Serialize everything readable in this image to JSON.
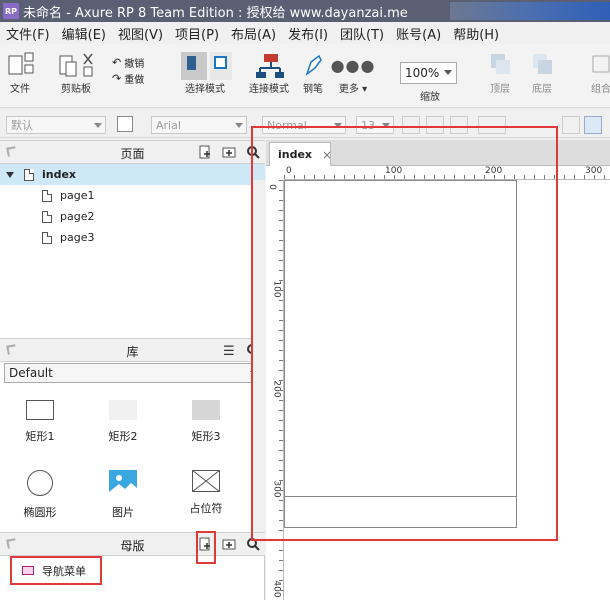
{
  "window": {
    "title": "未命名 - Axure RP 8 Team Edition : 授权给 www.dayanzai.me",
    "logo": "RP"
  },
  "menu": [
    "文件(F)",
    "编辑(E)",
    "视图(V)",
    "项目(P)",
    "布局(A)",
    "发布(I)",
    "团队(T)",
    "账号(A)",
    "帮助(H)"
  ],
  "toolbar": {
    "file": "文件",
    "clipboard": "剪贴板",
    "undo": "撤销",
    "redo": "重做",
    "select_mode": "选择模式",
    "connect_mode": "连接模式",
    "pen": "钢笔",
    "more": "更多",
    "zoom_value": "100%",
    "zoom_label": "缩放",
    "top_layer": "顶层",
    "bottom_layer": "底层",
    "group": "组合"
  },
  "format": {
    "style": "默认",
    "font": "Arial",
    "weight": "Normal",
    "size": "13"
  },
  "pages_panel": {
    "title": "页面",
    "items": [
      {
        "label": "index"
      },
      {
        "label": "page1"
      },
      {
        "label": "page2"
      },
      {
        "label": "page3"
      }
    ]
  },
  "library_panel": {
    "title": "库",
    "selected": "Default",
    "widgets": [
      "矩形1",
      "矩形2",
      "矩形3",
      "椭圆形",
      "图片",
      "占位符"
    ]
  },
  "masters_panel": {
    "title": "母版",
    "items": [
      "导航菜单"
    ]
  },
  "canvas": {
    "tab": "index",
    "ruler_h": [
      "0",
      "100",
      "200",
      "300"
    ],
    "ruler_v": [
      "0",
      "100",
      "200",
      "300",
      "400"
    ]
  },
  "colors": {
    "highlight": "#e0393a",
    "selected_row": "#cfe8f8",
    "titlebar": "#5b5f73"
  }
}
